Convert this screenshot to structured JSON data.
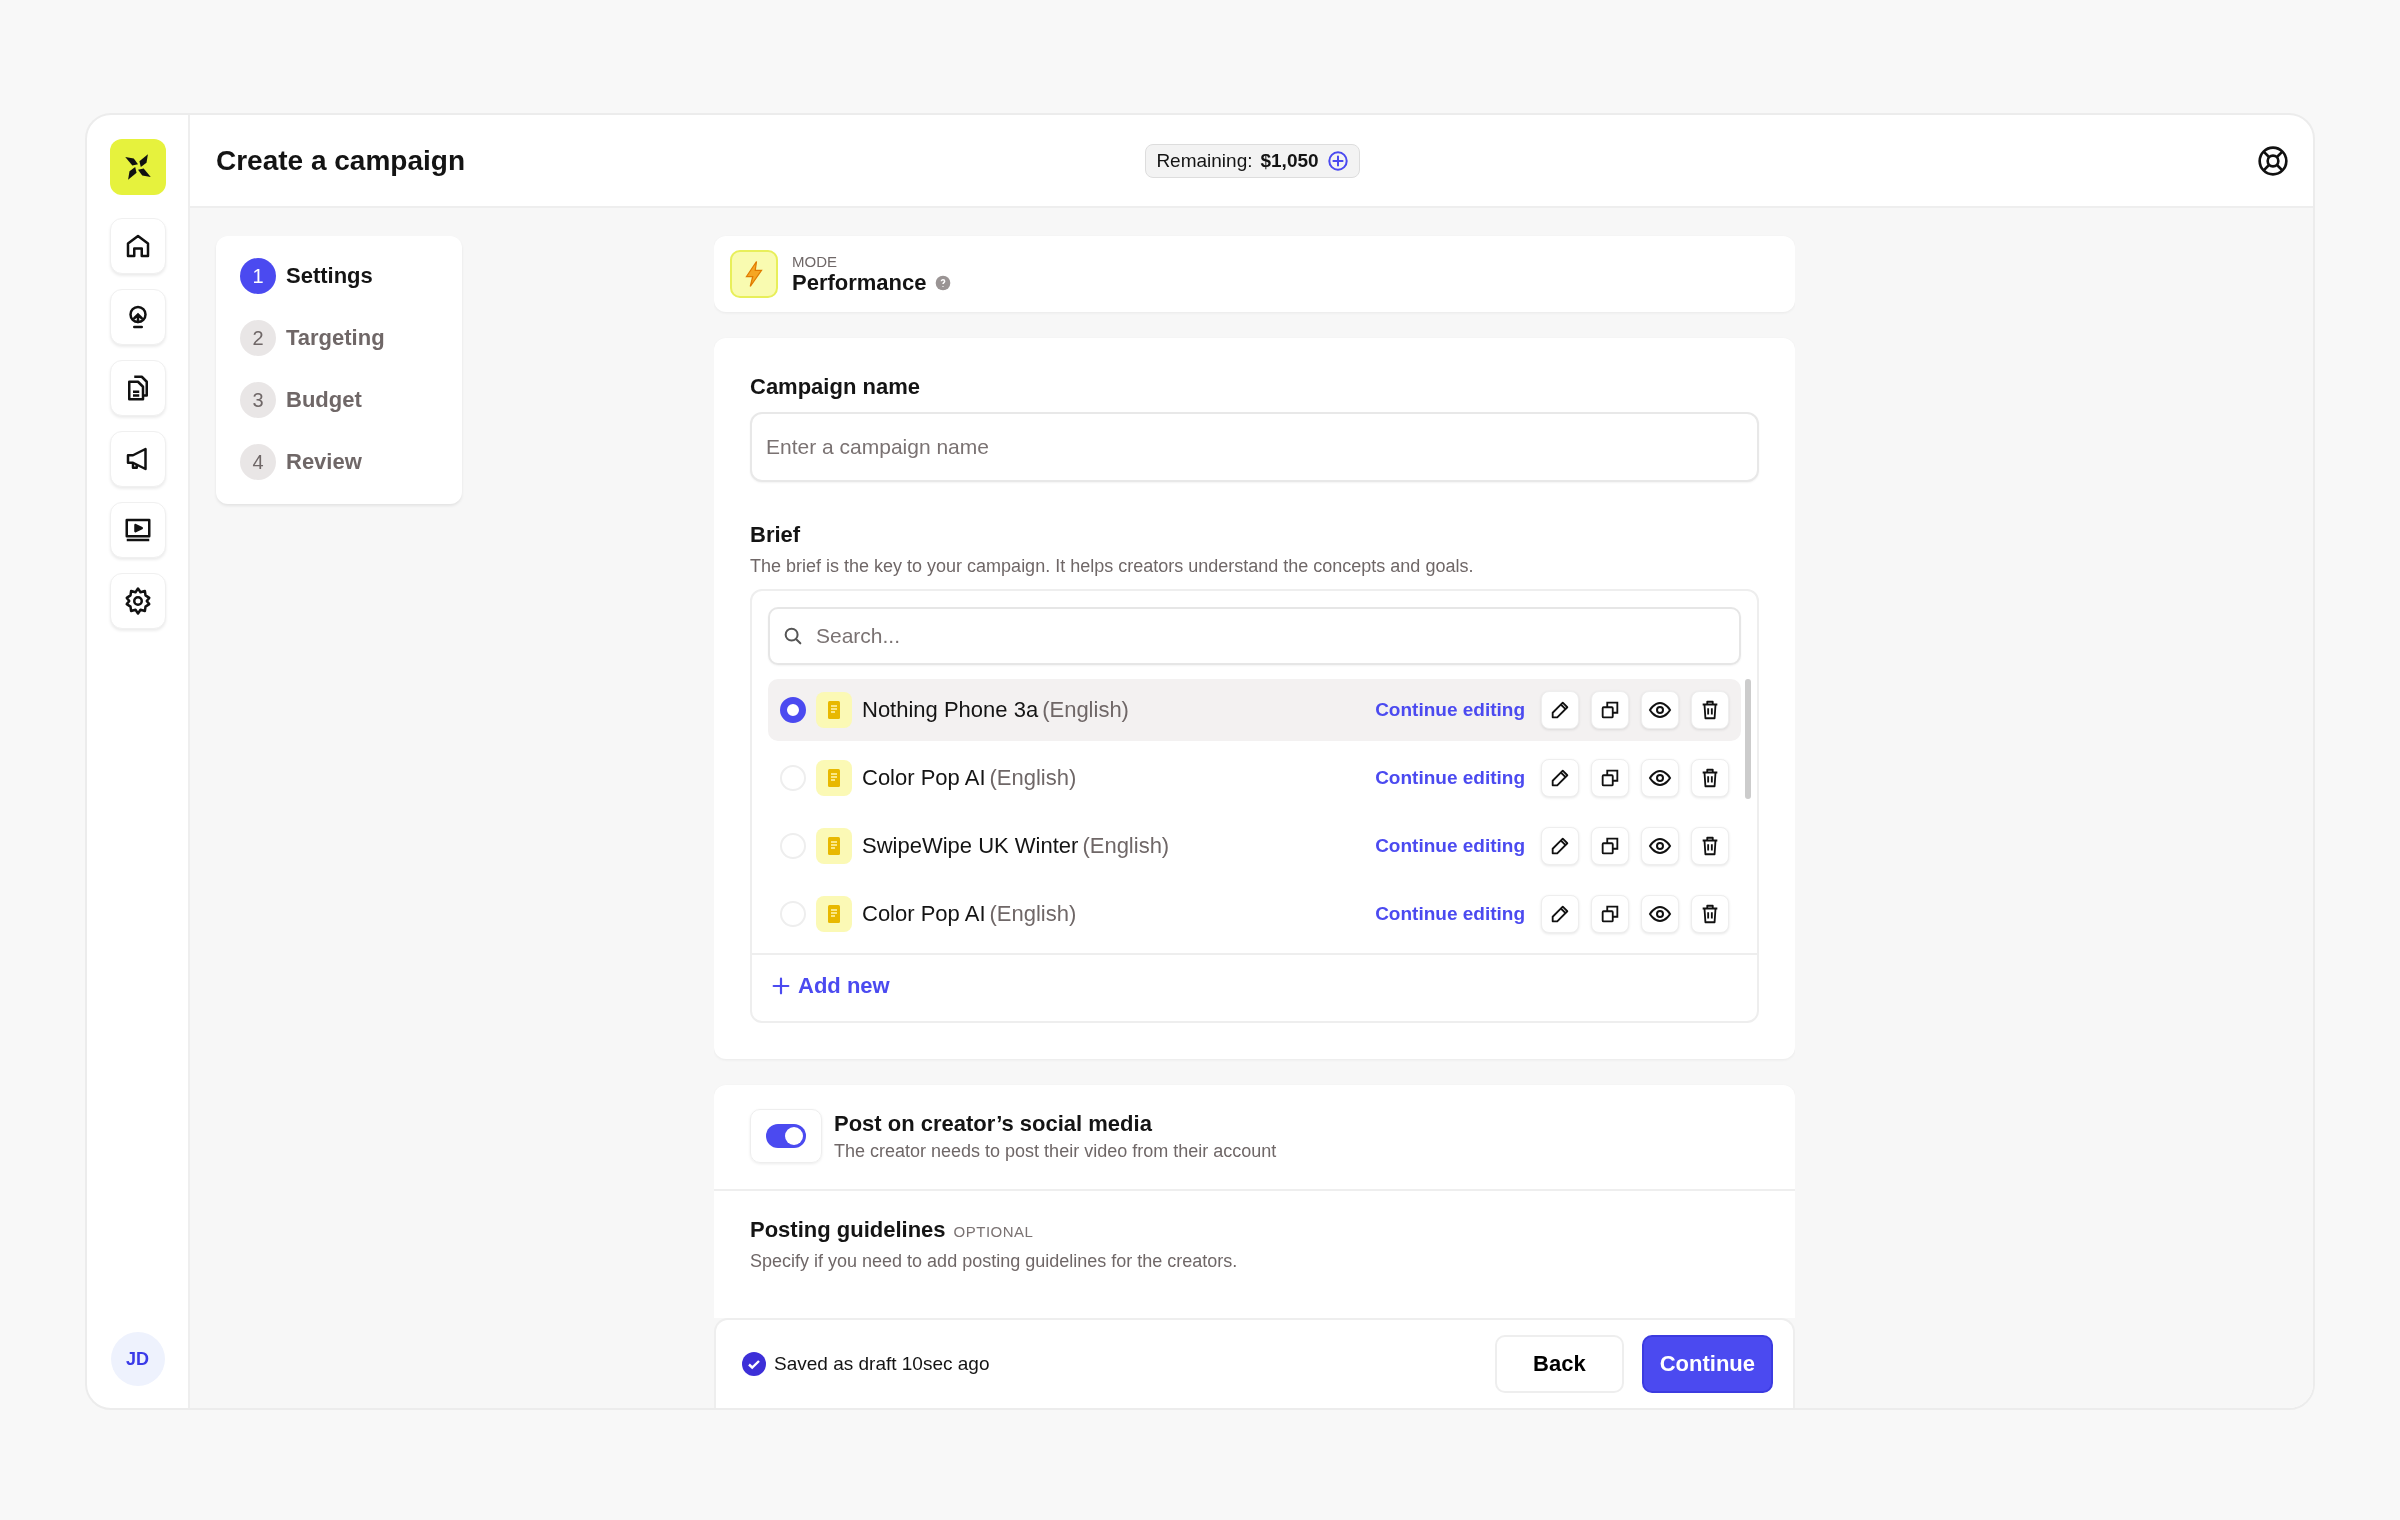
{
  "header": {
    "title": "Create a campaign",
    "remaining_label": "Remaining:",
    "remaining_amount": "$1,050"
  },
  "sidebar": {
    "avatar": "JD"
  },
  "steps": [
    {
      "number": "1",
      "label": "Settings",
      "selected": true
    },
    {
      "number": "2",
      "label": "Targeting",
      "selected": false
    },
    {
      "number": "3",
      "label": "Budget",
      "selected": false
    },
    {
      "number": "4",
      "label": "Review",
      "selected": false
    }
  ],
  "mode": {
    "label": "MODE",
    "value": "Performance"
  },
  "campaign_name": {
    "label": "Campaign name",
    "placeholder": "Enter a campaign name"
  },
  "brief": {
    "label": "Brief",
    "description": "The brief is the key to your campaign. It helps creators understand the concepts and goals.",
    "search": {
      "placeholder": "Search..."
    },
    "items": [
      {
        "name": "Nothing Phone 3a",
        "language": "(English)",
        "action": "Continue editing",
        "selected": true
      },
      {
        "name": "Color Pop AI",
        "language": "(English)",
        "action": "Continue editing",
        "selected": false
      },
      {
        "name": "SwipeWipe UK Winter",
        "language": "(English)",
        "action": "Continue editing",
        "selected": false
      },
      {
        "name": "Color Pop AI",
        "language": "(English)",
        "action": "Continue editing",
        "selected": false
      }
    ],
    "add_new": "Add new"
  },
  "social": {
    "on": true,
    "title": "Post on creator’s social media",
    "description": "The creator needs to post their video from their account"
  },
  "guidelines": {
    "title": "Posting guidelines",
    "tag": "OPTIONAL",
    "description": "Specify if you need to add posting guidelines for the creators."
  },
  "footer": {
    "status": "Saved as draft 10sec ago",
    "back": "Back",
    "continue": "Continue"
  }
}
